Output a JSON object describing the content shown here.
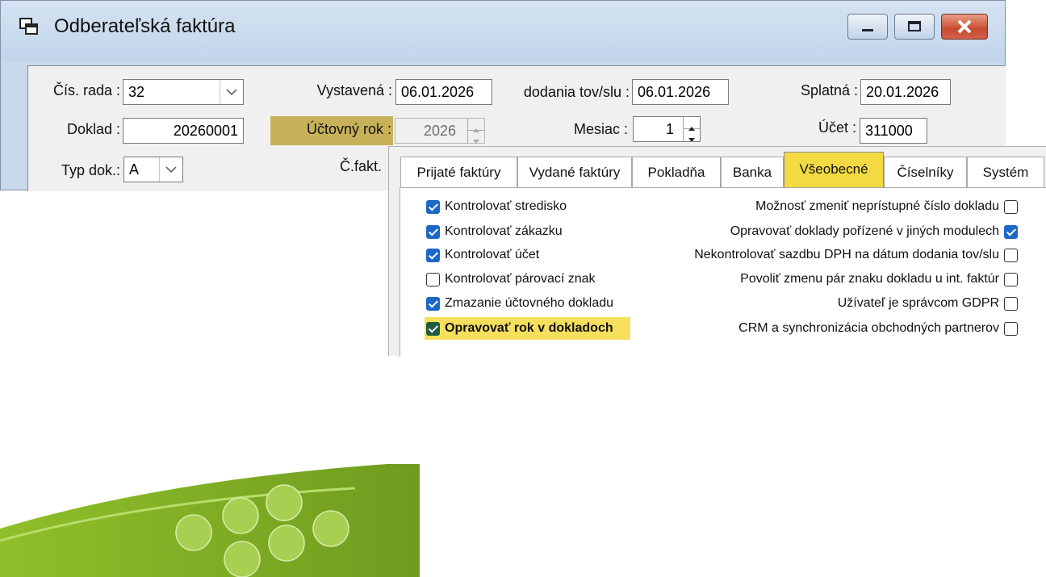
{
  "window": {
    "title": "Odberateľská faktúra",
    "fields": {
      "cis_rada_label": "Čís. rada :",
      "cis_rada_value": "32",
      "doklad_label": "Doklad :",
      "doklad_value": "20260001",
      "typ_dok_label": "Typ dok.:",
      "typ_dok_value": "A",
      "vystavena_label": "Vystavená :",
      "vystavena_value": "06.01.2026",
      "uctovny_rok_label": "Účtovný rok :",
      "uctovny_rok_value": "2026",
      "c_fakt_label": "Č.fakt.",
      "dodania_label": "dodania tov/slu :",
      "dodania_value": "06.01.2026",
      "mesiac_label": "Mesiac :",
      "mesiac_value": "1",
      "splatna_label": "Splatná :",
      "splatna_value": "20.01.2026",
      "ucet_label": "Účet :",
      "ucet_value": "311000"
    }
  },
  "dialog": {
    "tabs": [
      "Prijaté faktúry",
      "Vydané faktúry",
      "Pokladňa",
      "Banka",
      "Všeobecné",
      "Číselníky",
      "Systém"
    ],
    "active_tab": "Všeobecné",
    "left_options": [
      {
        "label": "Kontrolovať stredisko",
        "checked": true
      },
      {
        "label": "Kontrolovať zákazku",
        "checked": true
      },
      {
        "label": "Kontrolovať účet",
        "checked": true
      },
      {
        "label": "Kontrolovať párovací znak",
        "checked": false
      },
      {
        "label": "Zmazanie účtovného dokladu",
        "checked": true
      },
      {
        "label": "Opravovať rok v dokladoch",
        "checked": true,
        "highlighted": true
      }
    ],
    "right_options": [
      {
        "label": "Možnosť zmeniť neprístupné číslo dokladu",
        "checked": false
      },
      {
        "label": "Opravovať doklady pořízené v jiných modulech",
        "checked": true
      },
      {
        "label": "Nekontrolovať sazdbu DPH na dátum dodania tov/slu",
        "checked": false
      },
      {
        "label": "Povoliť zmenu pár znaku dokladu u int. faktúr",
        "checked": false
      },
      {
        "label": "Užívateľ je správcom GDPR",
        "checked": false
      },
      {
        "label": "CRM a synchronizácia obchodných partnerov",
        "checked": false
      }
    ]
  },
  "colors": {
    "accent_tab": "#f3da42",
    "checkbox_checked": "#1d67c6",
    "highlight": "#f5df5c",
    "field_highlight": "#c7b25a"
  }
}
